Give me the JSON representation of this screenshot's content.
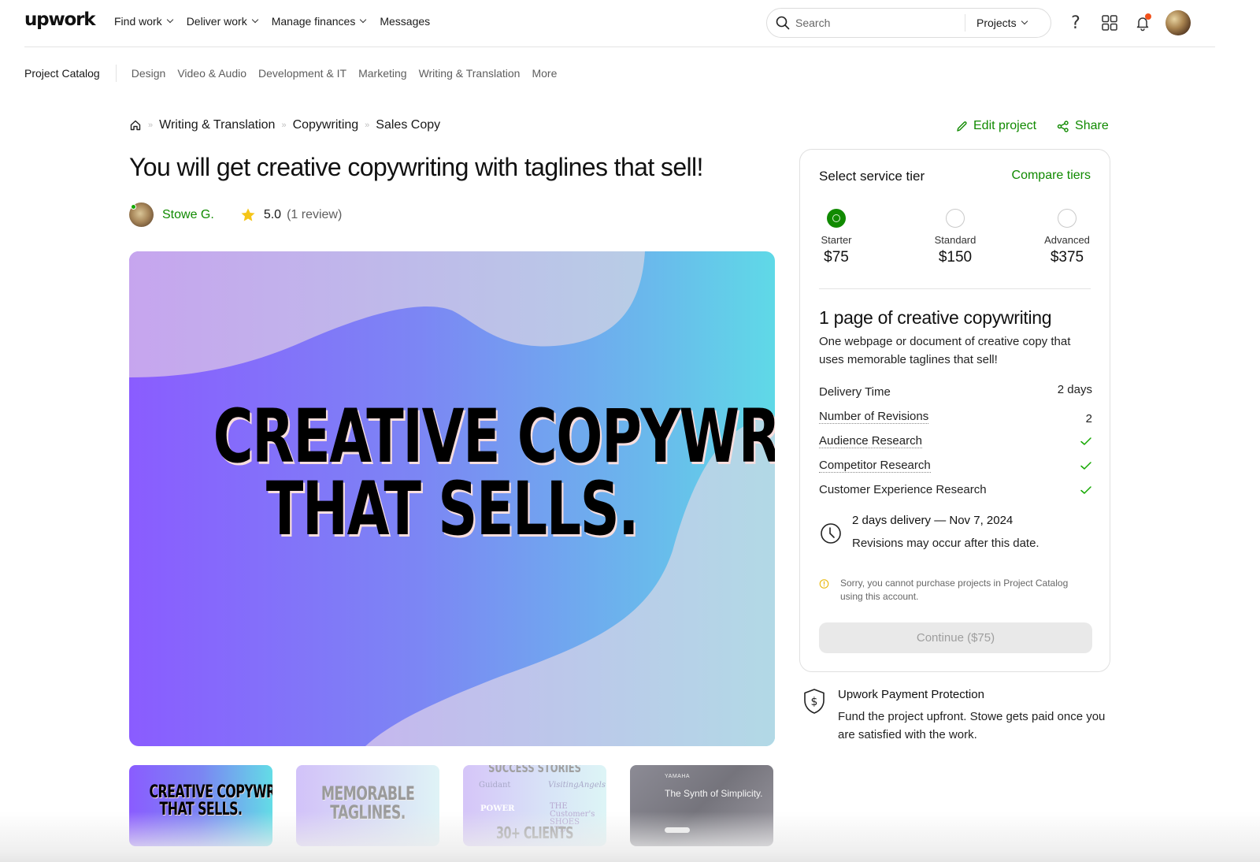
{
  "header": {
    "logo": "upwork",
    "nav": [
      {
        "label": "Find work",
        "has_dropdown": true
      },
      {
        "label": "Deliver work",
        "has_dropdown": true
      },
      {
        "label": "Manage finances",
        "has_dropdown": true
      },
      {
        "label": "Messages",
        "has_dropdown": false
      }
    ],
    "search": {
      "placeholder": "Search",
      "value": "",
      "scope": "Projects"
    },
    "icons": [
      "help-icon",
      "apps-grid-icon",
      "notification-bell-icon",
      "user-avatar"
    ],
    "notification_badge": true
  },
  "category_nav": {
    "home": "Project Catalog",
    "items": [
      "Design",
      "Video & Audio",
      "Development & IT",
      "Marketing",
      "Writing & Translation",
      "More"
    ]
  },
  "breadcrumb": {
    "home_icon": "home-icon",
    "items": [
      "Writing & Translation",
      "Copywriting",
      "Sales Copy"
    ]
  },
  "actions": {
    "edit": "Edit project",
    "share": "Share"
  },
  "project": {
    "title": "You will get creative copywriting with taglines that sell!",
    "seller": {
      "name": "Stowe G.",
      "online": true
    },
    "rating": "5.0",
    "reviews": "(1 review)"
  },
  "gallery": {
    "hero": {
      "line1": "CREATIVE COPYWRITING",
      "line2": "THAT SELLS."
    },
    "thumbnails": [
      {
        "line1": "CREATIVE COPYWRITING",
        "line2": "THAT SELLS.",
        "selected": true
      },
      {
        "line1": "MEMORABLE",
        "line2": "TAGLINES.",
        "selected": false
      },
      {
        "top": "SUCCESS STORIES",
        "logos": [
          "Guidant",
          "VisitingAngels",
          "POWER",
          "THE Customer's SHOES LTD"
        ],
        "line1": "30+ CLIENTS",
        "selected": false
      },
      {
        "brand": "YAMAHA",
        "headline": "The Synth of Simplicity.",
        "selected": false
      }
    ]
  },
  "tier_card": {
    "title": "Select service tier",
    "compare": "Compare tiers",
    "tiers": [
      {
        "name": "Starter",
        "price": "$75",
        "selected": true
      },
      {
        "name": "Standard",
        "price": "$150",
        "selected": false
      },
      {
        "name": "Advanced",
        "price": "$375",
        "selected": false
      }
    ],
    "package_title": "1 page of creative copywriting",
    "package_desc": "One webpage or document of creative copy that uses memorable taglines that sell!",
    "features": [
      {
        "name": "Delivery Time",
        "value": "2 days",
        "type": "text",
        "dotted": false
      },
      {
        "name": "Number of Revisions",
        "value": "2",
        "type": "text",
        "dotted": true
      },
      {
        "name": "Audience Research",
        "value": "included",
        "type": "check",
        "dotted": true
      },
      {
        "name": "Competitor Research",
        "value": "included",
        "type": "check",
        "dotted": true
      },
      {
        "name": "Customer Experience Research",
        "value": "included",
        "type": "check",
        "dotted": false
      }
    ],
    "delivery_line": "2 days delivery — Nov 7, 2024",
    "delivery_note": "Revisions may occur after this date.",
    "warning": "Sorry, you cannot purchase projects in Project Catalog using this account.",
    "continue_label": "Continue ($75)",
    "continue_disabled": true
  },
  "protection": {
    "title": "Upwork Payment Protection",
    "desc": "Fund the project upfront. Stowe gets paid once you are satisfied with the work."
  },
  "colors": {
    "brand_green": "#108a00",
    "notification_red": "#f2511b",
    "star_yellow": "#f5c518",
    "warning_yellow": "#e8b500",
    "disabled_bg": "#e9e9e9"
  }
}
